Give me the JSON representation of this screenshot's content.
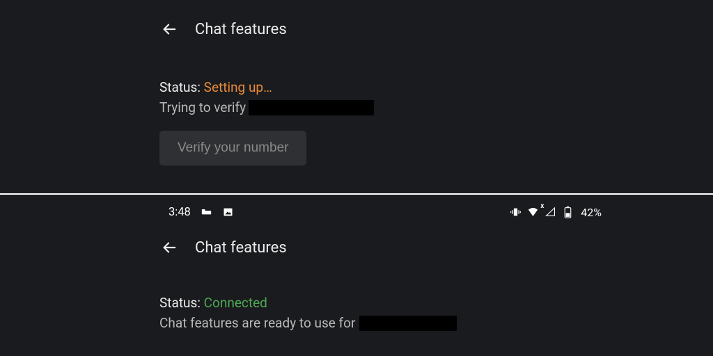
{
  "top": {
    "title": "Chat features",
    "status_label": "Status: ",
    "status_value": "Setting up…",
    "subline": "Trying to verify",
    "verify_button": "Verify your number"
  },
  "bottom": {
    "statusbar": {
      "time": "3:48",
      "battery": "42%",
      "wifi_overlay": "x"
    },
    "title": "Chat features",
    "status_label": "Status: ",
    "status_value": "Connected",
    "subline": "Chat features are ready to use for"
  }
}
